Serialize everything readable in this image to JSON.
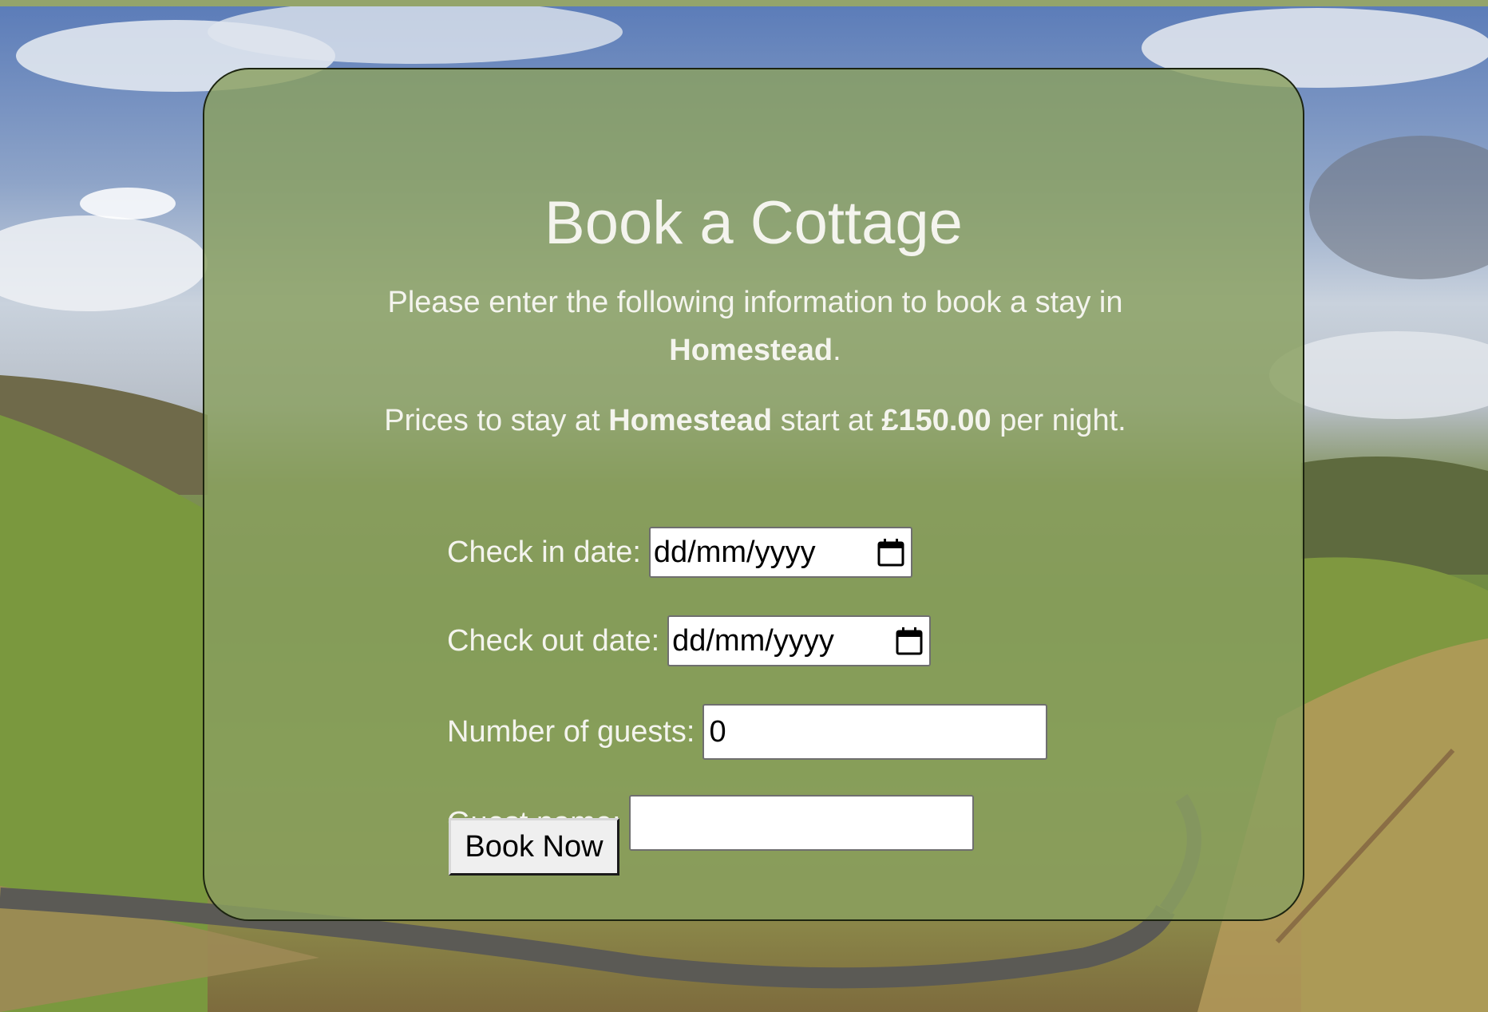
{
  "page": {
    "title": "Book a Cottage",
    "intro_text": "Please enter the following information to book a stay in",
    "cottage_name": "Homestead",
    "intro_suffix": ".",
    "prices_prefix": "Prices to stay at",
    "prices_middle": "start at",
    "price": "£150.00",
    "prices_suffix": "per night."
  },
  "form": {
    "check_in_label": "Check in date:",
    "check_in_placeholder": "dd/mm/yyyy",
    "check_out_label": "Check out date:",
    "check_out_placeholder": "dd/mm/yyyy",
    "guests_label": "Number of guests:",
    "guests_value": "0",
    "guest_name_label": "Guest name:",
    "guest_name_value": "",
    "submit_label": "Book Now"
  },
  "icons": {
    "calendar": "calendar-icon"
  },
  "colors": {
    "card_background": "#8aa05f",
    "text": "#f4f4ee",
    "top_bar": "#94a46b"
  }
}
